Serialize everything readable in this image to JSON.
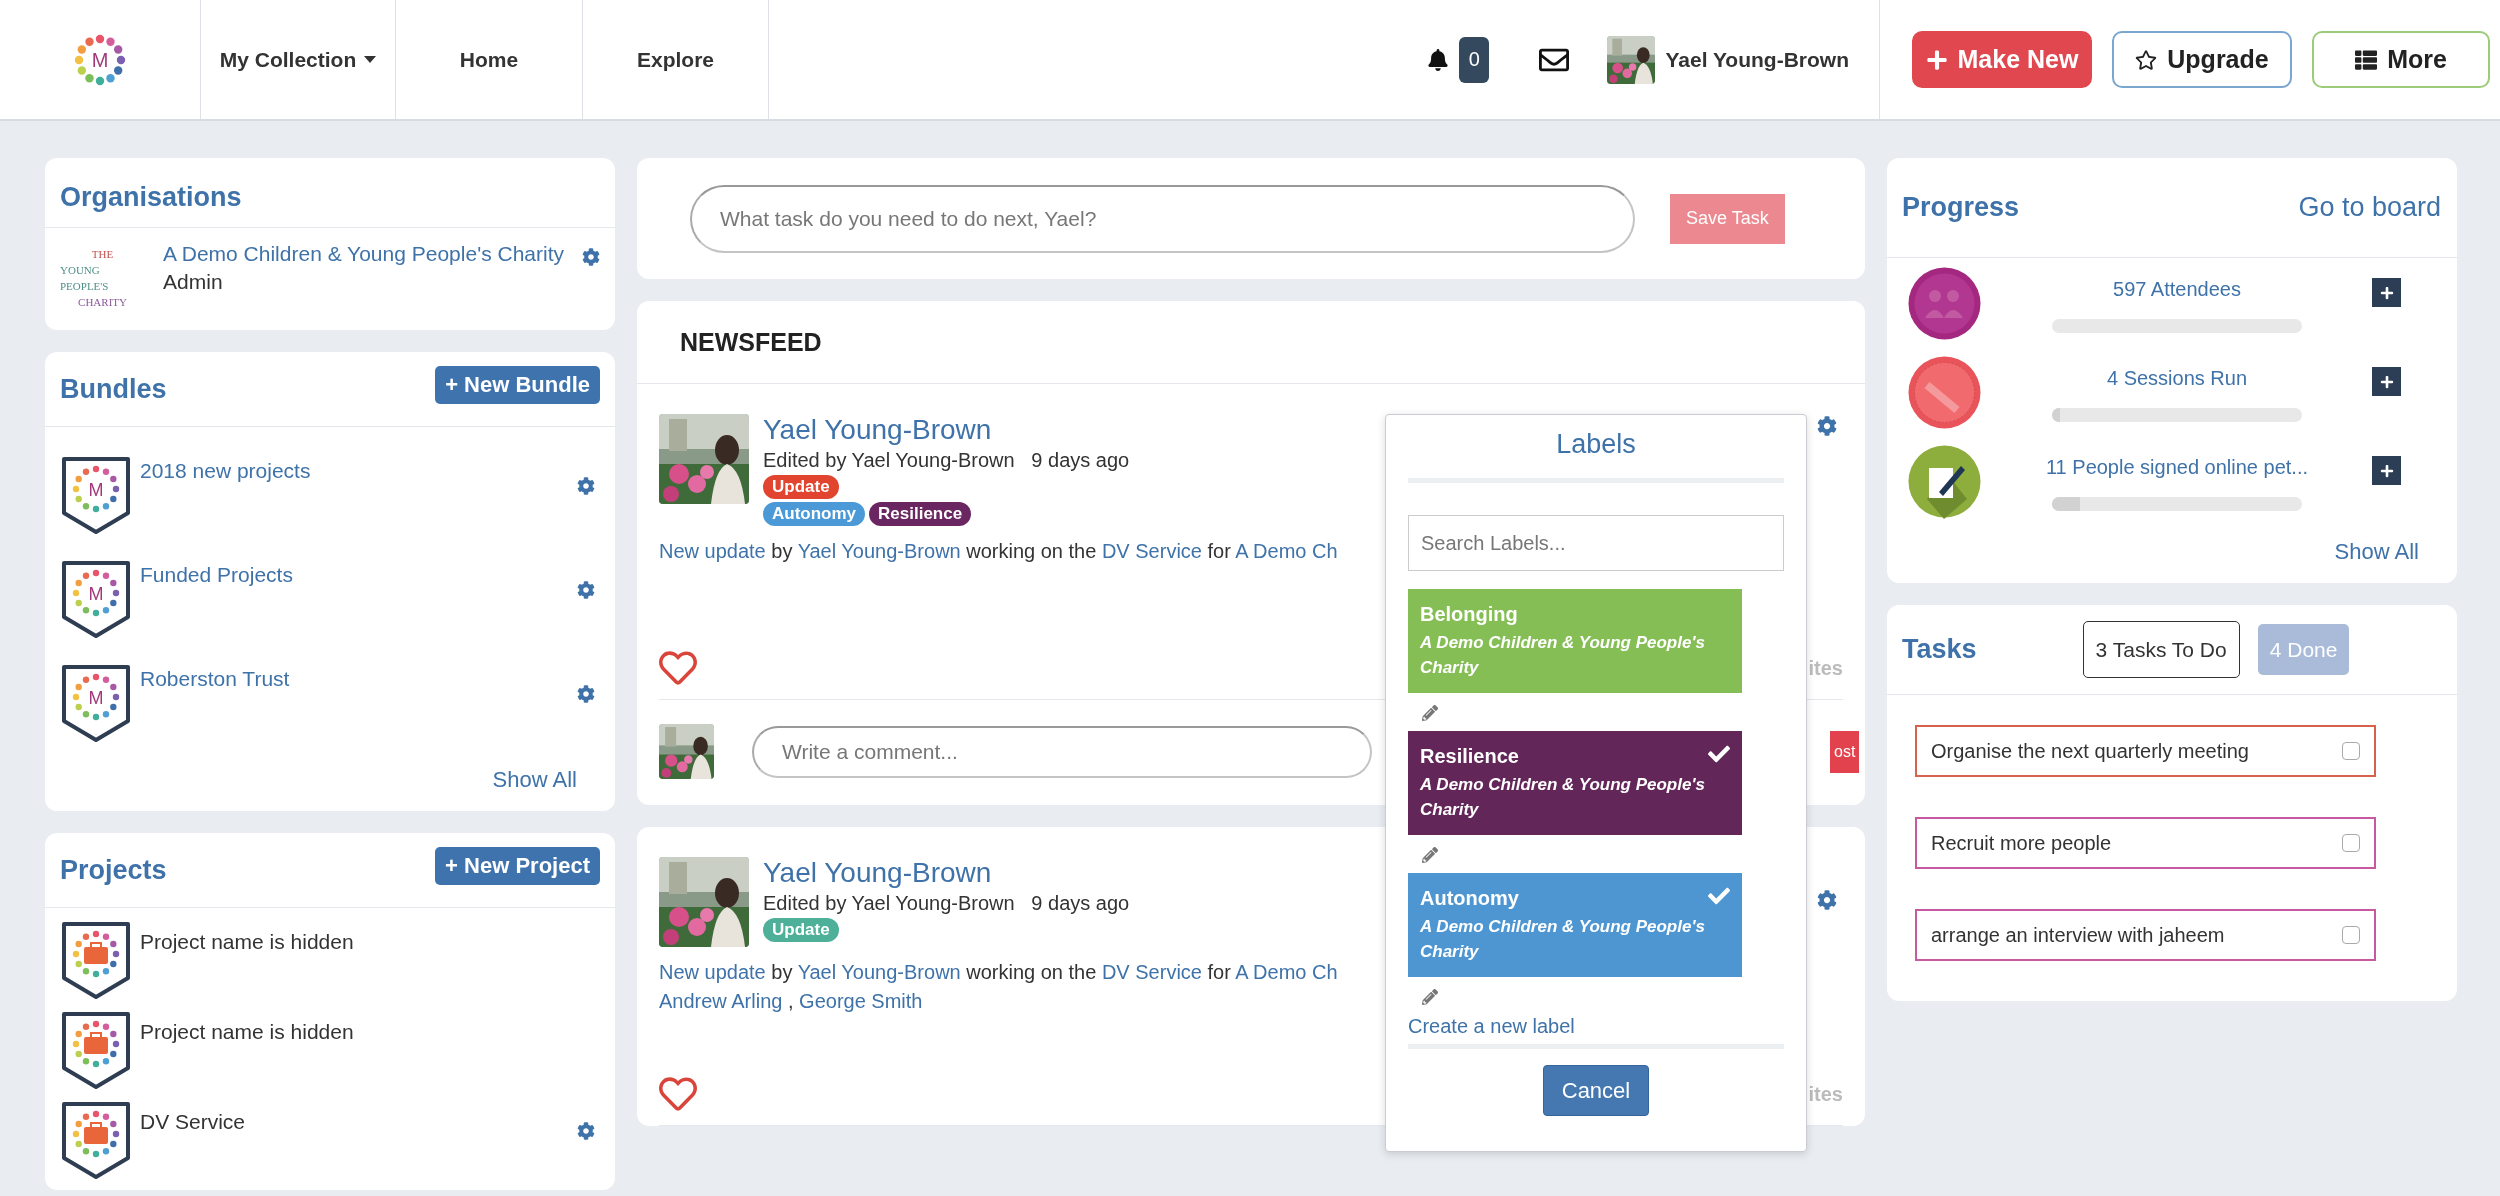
{
  "header": {
    "logo_letter": "M",
    "nav": [
      {
        "label": "My Collection",
        "dropdown": true
      },
      {
        "label": "Home",
        "dropdown": false
      },
      {
        "label": "Explore",
        "dropdown": false
      }
    ],
    "notifications": "0",
    "user_name": "Yael Young-Brown",
    "buttons": [
      {
        "label": "Make New",
        "kind": "make"
      },
      {
        "label": "Upgrade",
        "kind": "upgrade"
      },
      {
        "label": "More",
        "kind": "more"
      }
    ]
  },
  "organisations": {
    "title": "Organisations",
    "items": [
      {
        "logo_lines": [
          "THE",
          "YOUNG PEOPLE'S",
          "CHARITY"
        ],
        "name": "A Demo Children & Young People's Charity",
        "role": "Admin"
      }
    ]
  },
  "bundles": {
    "title": "Bundles",
    "new_button": "+ New Bundle",
    "items": [
      {
        "name": "2018 new projects",
        "badge_letter": "M"
      },
      {
        "name": "Funded Projects",
        "badge_letter": "M"
      },
      {
        "name": "Roberston Trust",
        "badge_letter": "M"
      }
    ],
    "show_all": "Show All"
  },
  "projects": {
    "title": "Projects",
    "new_button": "+ New Project",
    "items": [
      {
        "name": "Project name is hidden",
        "settings": false
      },
      {
        "name": "Project name is hidden",
        "settings": false
      },
      {
        "name": "DV Service",
        "settings": true
      }
    ]
  },
  "task_entry": {
    "placeholder": "What task do you need to do next, Yael?",
    "button": "Save Task"
  },
  "newsfeed": {
    "title": "NEWSFEED",
    "posts": [
      {
        "author": "Yael Young-Brown",
        "edited": "Edited by Yael Young-Brown",
        "time": "9 days ago",
        "tag_rows": [
          [
            {
              "label": "Update",
              "color": "#e2452f"
            }
          ],
          [
            {
              "label": "Autonomy",
              "color": "#4b99d6"
            },
            {
              "label": "Resilience",
              "color": "#6a2660"
            }
          ]
        ],
        "text_lines": [
          [
            {
              "text": "New update",
              "link": true
            },
            {
              "text": " by ",
              "link": false
            },
            {
              "text": "Yael Young-Brown",
              "link": true
            },
            {
              "text": " working on the ",
              "link": false
            },
            {
              "text": "DV Service",
              "link": true
            },
            {
              "text": " for ",
              "link": false
            },
            {
              "text": "A Demo Ch",
              "link": true
            }
          ]
        ],
        "favourites": "ites",
        "comment": {
          "placeholder": "Write a comment...",
          "button": "ost"
        }
      },
      {
        "author": "Yael Young-Brown",
        "edited": "Edited by Yael Young-Brown",
        "time": "9 days ago",
        "tag_rows": [
          [
            {
              "label": "Update",
              "color": "#4fb09a"
            }
          ]
        ],
        "text_lines": [
          [
            {
              "text": "New update",
              "link": true
            },
            {
              "text": " by ",
              "link": false
            },
            {
              "text": "Yael Young-Brown",
              "link": true
            },
            {
              "text": " working on the ",
              "link": false
            },
            {
              "text": "DV Service",
              "link": true
            },
            {
              "text": " for ",
              "link": false
            },
            {
              "text": "A Demo Ch",
              "link": true
            }
          ],
          [
            {
              "text": "Andrew Arling",
              "link": true
            },
            {
              "text": " , ",
              "link": false
            },
            {
              "text": "George Smith",
              "link": true
            }
          ]
        ],
        "favourites": "ites"
      }
    ]
  },
  "labels_popup": {
    "title": "Labels",
    "search_placeholder": "Search Labels...",
    "labels": [
      {
        "name": "Belonging",
        "org": "A Demo Children & Young People's Charity",
        "color": "#86be56",
        "checked": false
      },
      {
        "name": "Resilience",
        "org": "A Demo Children & Young People's Charity",
        "color": "#632659",
        "checked": true
      },
      {
        "name": "Autonomy",
        "org": "A Demo Children & Young People's Charity",
        "color": "#4e96d2",
        "checked": true
      }
    ],
    "create": "Create a new label",
    "cancel": "Cancel"
  },
  "progress": {
    "title": "Progress",
    "link": "Go to board",
    "items": [
      {
        "label": "597 Attendees",
        "level": 0,
        "kind": "people"
      },
      {
        "label": "4 Sessions Run",
        "level": 0.03,
        "kind": "button"
      },
      {
        "label": "11 People signed online pet...",
        "level": 0.11,
        "kind": "petition"
      }
    ],
    "show_all": "Show All"
  },
  "tasks": {
    "title": "Tasks",
    "tabs": [
      {
        "label": "3 Tasks To Do",
        "selected": true
      },
      {
        "label": "4 Done",
        "selected": false
      }
    ],
    "items": [
      {
        "text": "Organise the next quarterly meeting",
        "color": "#d8614b",
        "checked": false
      },
      {
        "text": "Recruit more people",
        "color": "#c659a0",
        "checked": false
      },
      {
        "text": "arrange an interview with jaheem",
        "color": "#c659a0",
        "checked": false
      }
    ]
  }
}
